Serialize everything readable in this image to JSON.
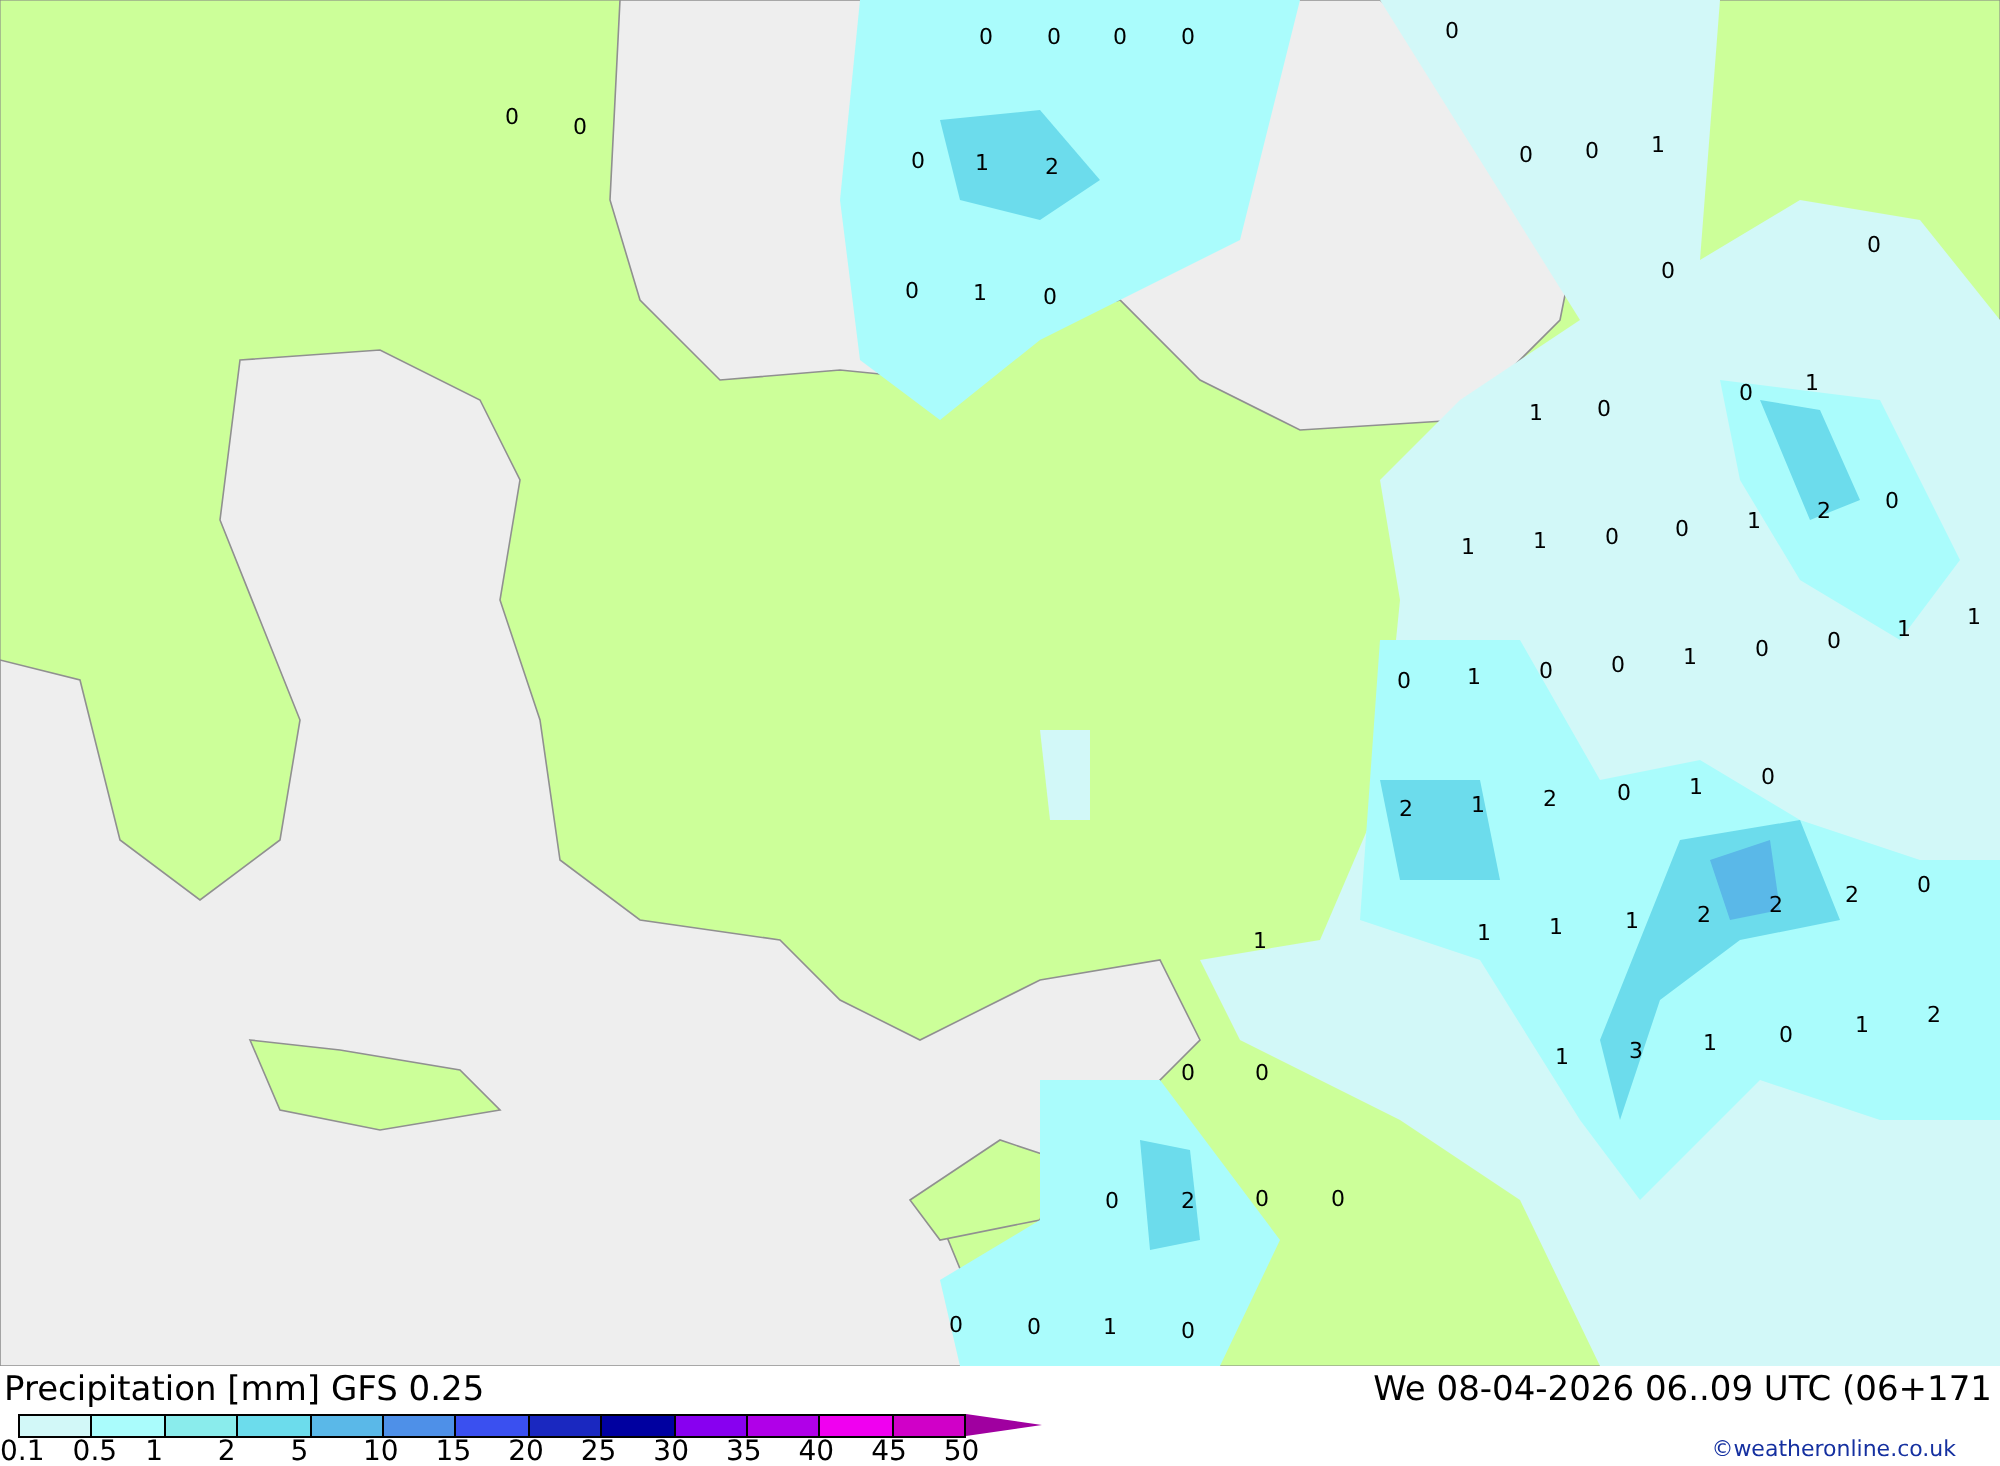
{
  "map": {
    "values": [
      "0",
      "0",
      "0",
      "0",
      "0",
      "0",
      "0",
      "0",
      "1",
      "2",
      "0",
      "0",
      "1",
      "0",
      "0",
      "1",
      "0",
      "0",
      "1",
      "0",
      "1",
      "0",
      "2",
      "0",
      "1",
      "1",
      "0",
      "0",
      "1",
      "0",
      "1",
      "0",
      "0",
      "1",
      "0",
      "0",
      "1",
      "1",
      "1",
      "0",
      "2",
      "1",
      "2",
      "0",
      "1",
      "1",
      "1",
      "1",
      "2",
      "2",
      "2",
      "0",
      "1",
      "3",
      "1",
      "0",
      "1",
      "2",
      "0",
      "0",
      "0",
      "2",
      "0",
      "0",
      "0",
      "0",
      "1",
      "0"
    ]
  },
  "legend": {
    "title": "Precipitation [mm] GFS 0.25",
    "datetime": "We 08-04-2026 06..09 UTC (06+171",
    "credit": "©weatheronline.co.uk",
    "segments": [
      {
        "color": "#d2f8f8"
      },
      {
        "color": "#aafcfc"
      },
      {
        "color": "#8aecec"
      },
      {
        "color": "#6cdcec"
      },
      {
        "color": "#5ab8e8"
      },
      {
        "color": "#4e90e8"
      },
      {
        "color": "#3a50f0"
      },
      {
        "color": "#1a28c0"
      },
      {
        "color": "#0000a0"
      },
      {
        "color": "#8800f0"
      },
      {
        "color": "#b000e8"
      },
      {
        "color": "#f000f0"
      },
      {
        "color": "#d000c8"
      }
    ],
    "labels": [
      "0.1",
      "0.5",
      "1",
      "2",
      "5",
      "10",
      "15",
      "20",
      "25",
      "30",
      "35",
      "40",
      "45",
      "50"
    ]
  }
}
